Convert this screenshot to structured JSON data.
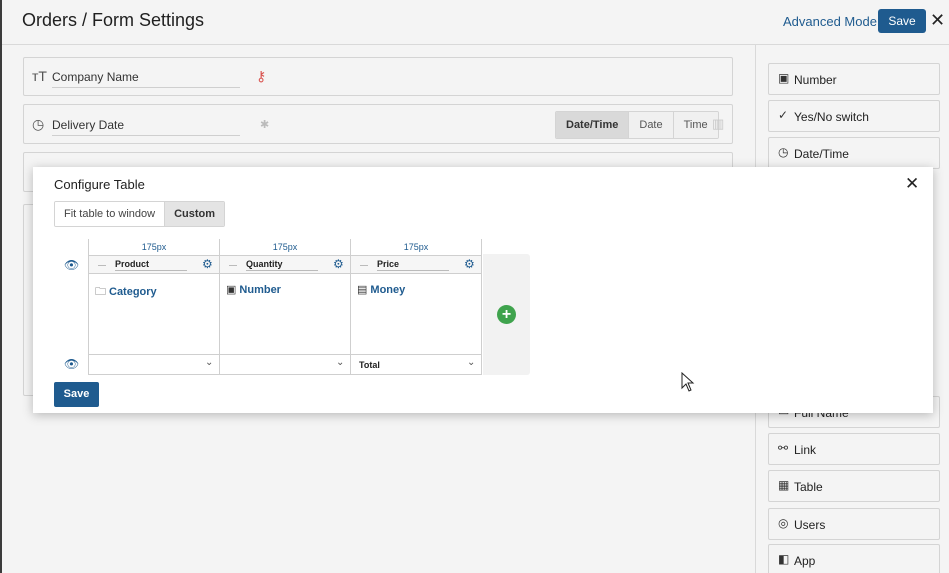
{
  "header": {
    "title": "Orders / Form Settings",
    "advanced_mode": "Advanced Mode",
    "save": "Save"
  },
  "form_fields": [
    {
      "label": "Company Name",
      "icon": "text-icon"
    },
    {
      "label": "Delivery Date",
      "icon": "clock-icon",
      "modes": [
        "Date/Time",
        "Date",
        "Time"
      ],
      "selected_mode": "Date/Time"
    }
  ],
  "sidebar": {
    "items": [
      {
        "label": "Number",
        "icon": "number-icon"
      },
      {
        "label": "Yes/No switch",
        "icon": "check-icon"
      },
      {
        "label": "Date/Time",
        "icon": "clock-icon"
      },
      {
        "label": "Full Name",
        "icon": "person-icon"
      },
      {
        "label": "Link",
        "icon": "link-icon"
      },
      {
        "label": "Table",
        "icon": "table-icon"
      },
      {
        "label": "Users",
        "icon": "user-icon"
      },
      {
        "label": "App",
        "icon": "app-icon"
      }
    ]
  },
  "modal": {
    "title": "Configure Table",
    "fit_option": "Fit table to window",
    "custom_option": "Custom",
    "selected_option": "Custom",
    "columns": [
      {
        "width_label": "175px",
        "name": "Product",
        "type": "Category",
        "type_icon": "folder-icon",
        "footer": ""
      },
      {
        "width_label": "175px",
        "name": "Quantity",
        "type": "Number",
        "type_icon": "number-icon",
        "footer": ""
      },
      {
        "width_label": "175px",
        "name": "Price",
        "type": "Money",
        "type_icon": "money-icon",
        "footer": "Total"
      }
    ],
    "save": "Save"
  },
  "colors": {
    "primary": "#1f5b8f",
    "add": "#3fa34d"
  }
}
